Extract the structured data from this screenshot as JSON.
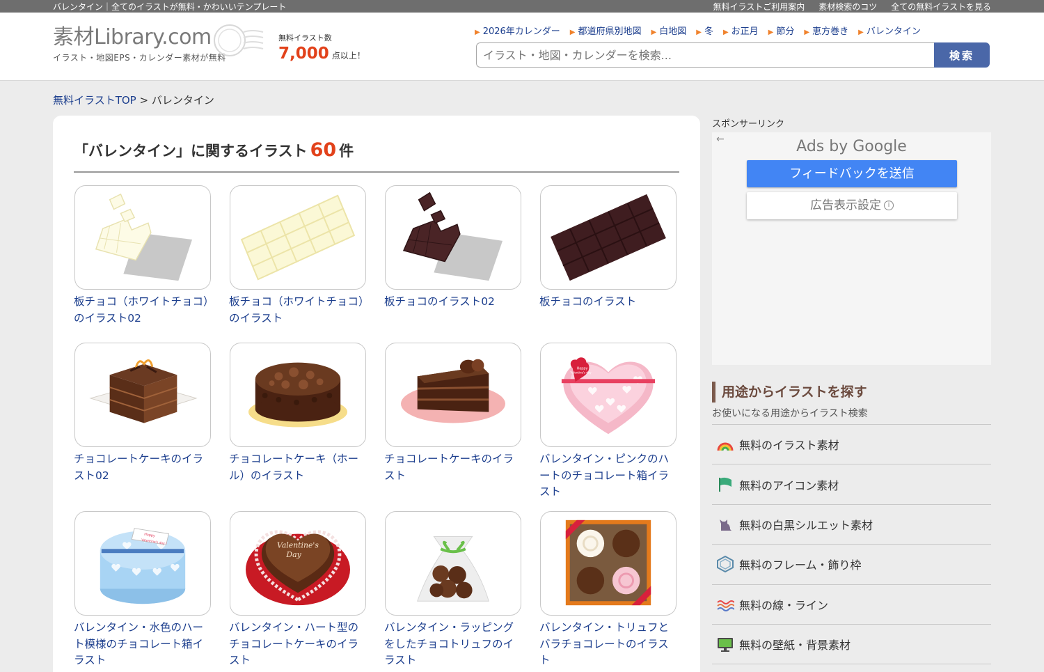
{
  "topbar": {
    "tagline": "バレンタイン｜全てのイラストが無料・かわいいテンプレート",
    "links": [
      "無料イラストご利用案内",
      "素材検索のコツ",
      "全ての無料イラストを見る"
    ]
  },
  "header": {
    "logo_main": "素材Library.com",
    "logo_sub": "イラスト・地図EPS・カレンダー素材が無料",
    "count_label": "無料イラスト数",
    "count_value": "7,000",
    "count_suffix": "点以上！",
    "nav_links": [
      "2026年カレンダー",
      "都道府県別地図",
      "白地図",
      "冬",
      "お正月",
      "節分",
      "恵方巻き",
      "バレンタイン"
    ],
    "search_placeholder": "イラスト・地図・カレンダーを検索...",
    "search_button": "検索"
  },
  "breadcrumb": {
    "top": "無料イラストTOP",
    "separator": ">",
    "current": "バレンタイン"
  },
  "main": {
    "heading_prefix": "「バレンタイン」に関するイラスト",
    "heading_count": "60",
    "heading_suffix": "件",
    "items": [
      {
        "caption": "板チョコ（ホワイトチョコ）のイラスト02",
        "icon": "white-choco-broken-icon"
      },
      {
        "caption": "板チョコ（ホワイトチョコ）のイラスト",
        "icon": "white-choco-bar-icon"
      },
      {
        "caption": "板チョコのイラスト02",
        "icon": "choco-broken-icon"
      },
      {
        "caption": "板チョコのイラスト",
        "icon": "choco-bar-icon"
      },
      {
        "caption": "チョコレートケーキのイラスト02",
        "icon": "choco-cake-square-icon"
      },
      {
        "caption": "チョコレートケーキ（ホール）のイラスト",
        "icon": "choco-cake-whole-icon"
      },
      {
        "caption": "チョコレートケーキのイラスト",
        "icon": "choco-cake-slice-icon"
      },
      {
        "caption": "バレンタイン・ピンクのハートのチョコレート箱イラスト",
        "icon": "pink-heart-box-icon"
      },
      {
        "caption": "バレンタイン・水色のハート模様のチョコレート箱イラスト",
        "icon": "blue-heart-box-icon"
      },
      {
        "caption": "バレンタイン・ハート型のチョコレートケーキのイラスト",
        "icon": "heart-cake-icon"
      },
      {
        "caption": "バレンタイン・ラッピングをしたチョコトリュフのイラスト",
        "icon": "wrapped-truffle-icon"
      },
      {
        "caption": "バレンタイン・トリュフとバラチョコレートのイラスト",
        "icon": "truffle-box-icon"
      }
    ],
    "pink_box_text": [
      "Happy",
      "Valentine's day"
    ],
    "blue_box_text": [
      "Happy",
      "Valentine's day !"
    ],
    "heart_cake_text": [
      "Valentine's",
      "Day"
    ]
  },
  "sidebar": {
    "sponsor_label": "スポンサーリンク",
    "ad": {
      "title": "Ads by Google",
      "button_primary": "フィードバックを送信",
      "button_secondary": "広告表示設定",
      "info_glyph": "i",
      "back_glyph": "←"
    },
    "section_title": "用途からイラストを探す",
    "section_sub": "お使いになる用途からイラスト検索",
    "items": [
      {
        "label": "無料のイラスト素材",
        "icon": "rainbow-icon"
      },
      {
        "label": "無料のアイコン素材",
        "icon": "flag-icon"
      },
      {
        "label": "無料の白黒シルエット素材",
        "icon": "cat-silhouette-icon"
      },
      {
        "label": "無料のフレーム・飾り枠",
        "icon": "frame-icon"
      },
      {
        "label": "無料の線・ライン",
        "icon": "wave-line-icon"
      },
      {
        "label": "無料の壁紙・背景素材",
        "icon": "monitor-icon"
      }
    ]
  },
  "colors": {
    "accent": "#e2421b",
    "link": "#1d3f8e",
    "search_button": "#4a67a8",
    "ad_button": "#4285f4",
    "section_border": "#7b5a4c"
  }
}
